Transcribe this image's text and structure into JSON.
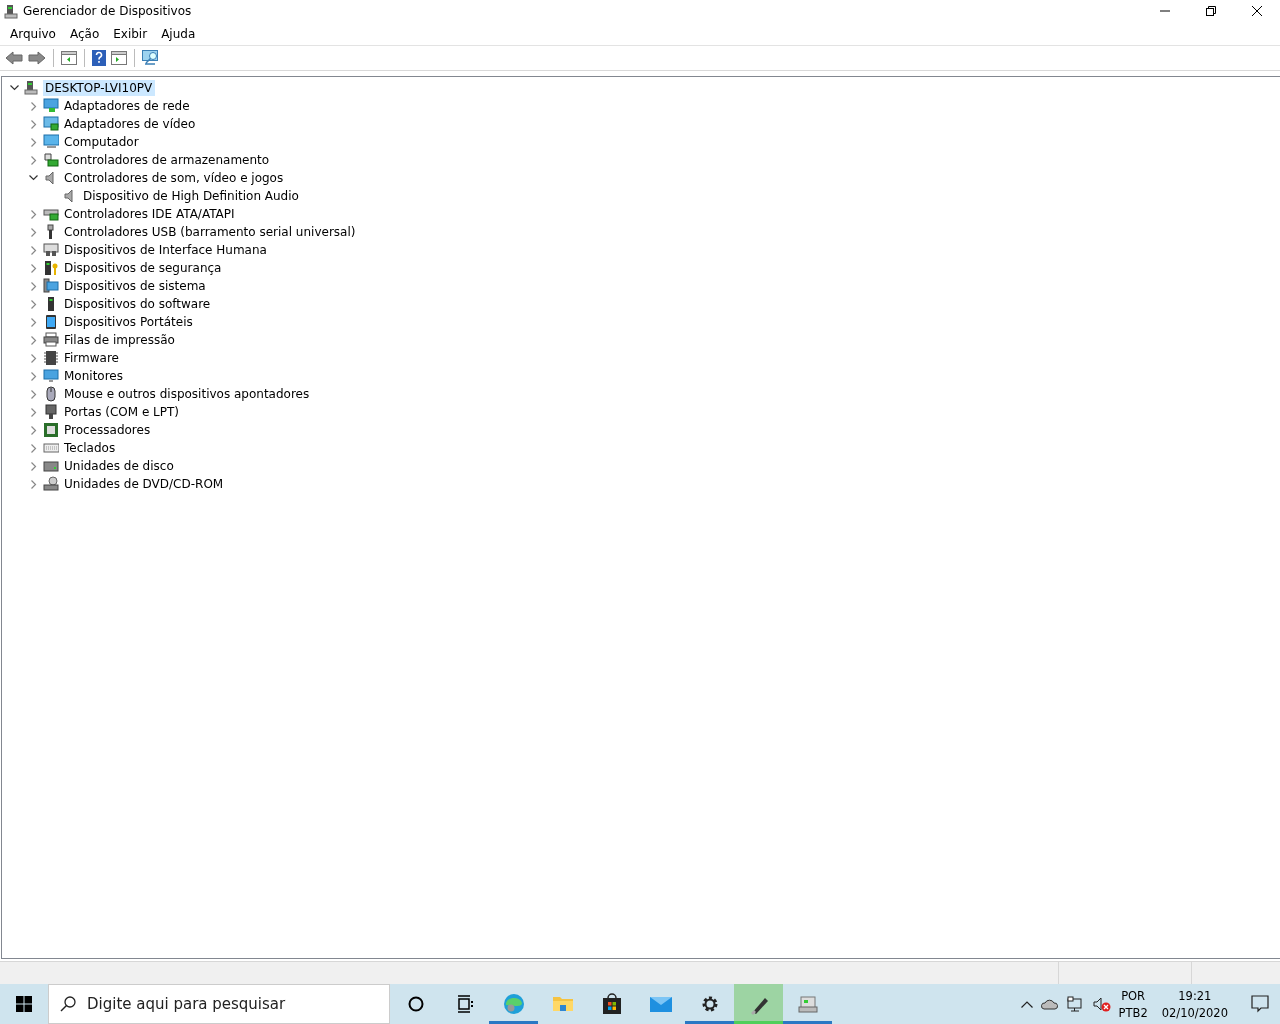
{
  "window": {
    "title": "Gerenciador de Dispositivos"
  },
  "menu": [
    "Arquivo",
    "Ação",
    "Exibir",
    "Ajuda"
  ],
  "tree": {
    "label": "DESKTOP-LVI10PV",
    "selected": true,
    "expanded": true,
    "children": [
      {
        "label": "Adaptadores de rede",
        "expanded": false,
        "selected": false
      },
      {
        "label": "Adaptadores de vídeo",
        "expanded": false,
        "selected": false
      },
      {
        "label": "Computador",
        "expanded": false,
        "selected": false
      },
      {
        "label": "Controladores de armazenamento",
        "expanded": false,
        "selected": false
      },
      {
        "label": "Controladores de som, vídeo e jogos",
        "expanded": true,
        "selected": false,
        "children": [
          {
            "label": "Dispositivo de High Definition Audio",
            "selected": false
          }
        ]
      },
      {
        "label": "Controladores IDE ATA/ATAPI",
        "expanded": false,
        "selected": false
      },
      {
        "label": "Controladores USB (barramento serial universal)",
        "expanded": false,
        "selected": false
      },
      {
        "label": "Dispositivos de Interface Humana",
        "expanded": false,
        "selected": false
      },
      {
        "label": "Dispositivos de segurança",
        "expanded": false,
        "selected": false
      },
      {
        "label": "Dispositivos de sistema",
        "expanded": false,
        "selected": false
      },
      {
        "label": "Dispositivos do software",
        "expanded": false,
        "selected": false
      },
      {
        "label": "Dispositivos Portáteis",
        "expanded": false,
        "selected": false
      },
      {
        "label": "Filas de impressão",
        "expanded": false,
        "selected": false
      },
      {
        "label": "Firmware",
        "expanded": false,
        "selected": false
      },
      {
        "label": "Monitores",
        "expanded": false,
        "selected": false
      },
      {
        "label": "Mouse e outros dispositivos apontadores",
        "expanded": false,
        "selected": false
      },
      {
        "label": "Portas (COM e LPT)",
        "expanded": false,
        "selected": false
      },
      {
        "label": "Processadores",
        "expanded": false,
        "selected": false
      },
      {
        "label": "Teclados",
        "expanded": false,
        "selected": false
      },
      {
        "label": "Unidades de disco",
        "expanded": false,
        "selected": false
      },
      {
        "label": "Unidades de DVD/CD-ROM",
        "expanded": false,
        "selected": false
      }
    ]
  },
  "taskbar": {
    "search": {
      "placeholder": "Digite aqui para pesquisar"
    },
    "apps": [
      {
        "running": false,
        "active": false
      },
      {
        "running": false,
        "active": false
      },
      {
        "running": true,
        "active": false
      },
      {
        "running": false,
        "active": false
      },
      {
        "running": false,
        "active": false
      },
      {
        "running": false,
        "active": false
      },
      {
        "running": true,
        "active": false
      },
      {
        "running": true,
        "active": true
      },
      {
        "running": true,
        "active": false
      }
    ],
    "tray": {
      "language": "POR",
      "layout": "PTB2",
      "time": "19:21",
      "date": "02/10/2020"
    }
  }
}
